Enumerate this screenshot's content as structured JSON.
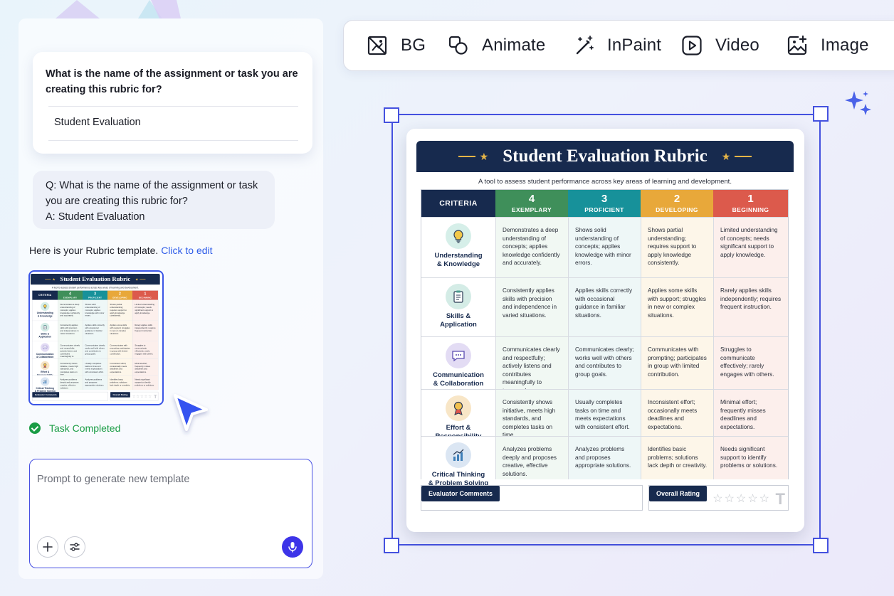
{
  "chat": {
    "question_card": {
      "question": "What is the name of the assignment or task you are creating this rubric for?",
      "answer": "Student Evaluation"
    },
    "qa_bubble": {
      "line1": "Q: What is the name of the assignment or task",
      "line2": "you are creating this rubric for?",
      "line3": "A: Student Evaluation"
    },
    "template_message": "Here is your Rubric  template.",
    "edit_link": "Click to edit",
    "task_status": "Task Completed",
    "prompt_placeholder": "Prompt to generate new template"
  },
  "toolbar": [
    {
      "label": "BG",
      "icon": "bg-remove-icon"
    },
    {
      "label": "Animate",
      "icon": "animate-icon"
    },
    {
      "label": "InPaint",
      "icon": "magic-wand-icon"
    },
    {
      "label": "Video",
      "icon": "video-play-icon"
    },
    {
      "label": "Image",
      "icon": "image-add-icon"
    }
  ],
  "rubric": {
    "title": "Student Evaluation Rubric",
    "subtitle": "A tool to assess student performance across key areas of learning and development.",
    "criteria_header": "CRITERIA",
    "levels": [
      {
        "num": "4",
        "label": "EXEMPLARY",
        "color": "#3f8f5a"
      },
      {
        "num": "3",
        "label": "PROFICIENT",
        "color": "#17919a"
      },
      {
        "num": "2",
        "label": "DEVELOPING",
        "color": "#e8a83a"
      },
      {
        "num": "1",
        "label": "BEGINNING",
        "color": "#dc5a4c"
      }
    ],
    "rows": [
      {
        "l1": "Understanding",
        "l2": "& Knowledge",
        "icon": "lightbulb-icon",
        "cells": [
          "Demonstrates a deep understanding of concepts; applies knowledge confidently and accurately.",
          "Shows solid understanding of concepts; applies knowledge with minor errors.",
          "Shows partial understanding; requires support to apply knowledge consistently.",
          "Limited understanding of concepts; needs significant support to apply knowledge."
        ]
      },
      {
        "l1": "Skills &",
        "l2": "Application",
        "icon": "clipboard-icon",
        "cells": [
          "Consistently applies skills with precision and independence in varied situations.",
          "Applies skills correctly with occasional guidance in familiar situations.",
          "Applies some skills with support; struggles in new or complex situations.",
          "Rarely applies skills independently; requires frequent instruction."
        ]
      },
      {
        "l1": "Communication",
        "l2": "& Collaboration",
        "icon": "chat-icon",
        "cells": [
          "Communicates clearly and respectfully; actively listens and contributes meaningfully to teamwork.",
          "Communicates clearly; works well with others and contributes to group goals.",
          "Communicates with prompting; participates in group with limited contribution.",
          "Struggles to communicate effectively; rarely engages with others."
        ]
      },
      {
        "l1": "Effort &",
        "l2": "Responsibility",
        "icon": "award-icon",
        "cells": [
          "Consistently shows initiative, meets high standards, and completes tasks on time.",
          "Usually completes tasks on time and meets expectations with consistent effort.",
          "Inconsistent effort; occasionally meets deadlines and expectations.",
          "Minimal effort; frequently misses deadlines and expectations."
        ]
      },
      {
        "l1": "Critical Thinking",
        "l2": "& Problem Solving",
        "icon": "growth-chart-icon",
        "cells": [
          "Analyzes problems deeply and proposes creative, effective solutions.",
          "Analyzes problems and proposes appropriate solutions.",
          "Identifies basic problems; solutions lack depth or creativity.",
          "Needs significant support to identify problems or solutions."
        ]
      }
    ],
    "evaluator_label": "Evaluator Comments",
    "rating_label": "Overall Rating",
    "stars": "☆☆☆☆☆"
  }
}
